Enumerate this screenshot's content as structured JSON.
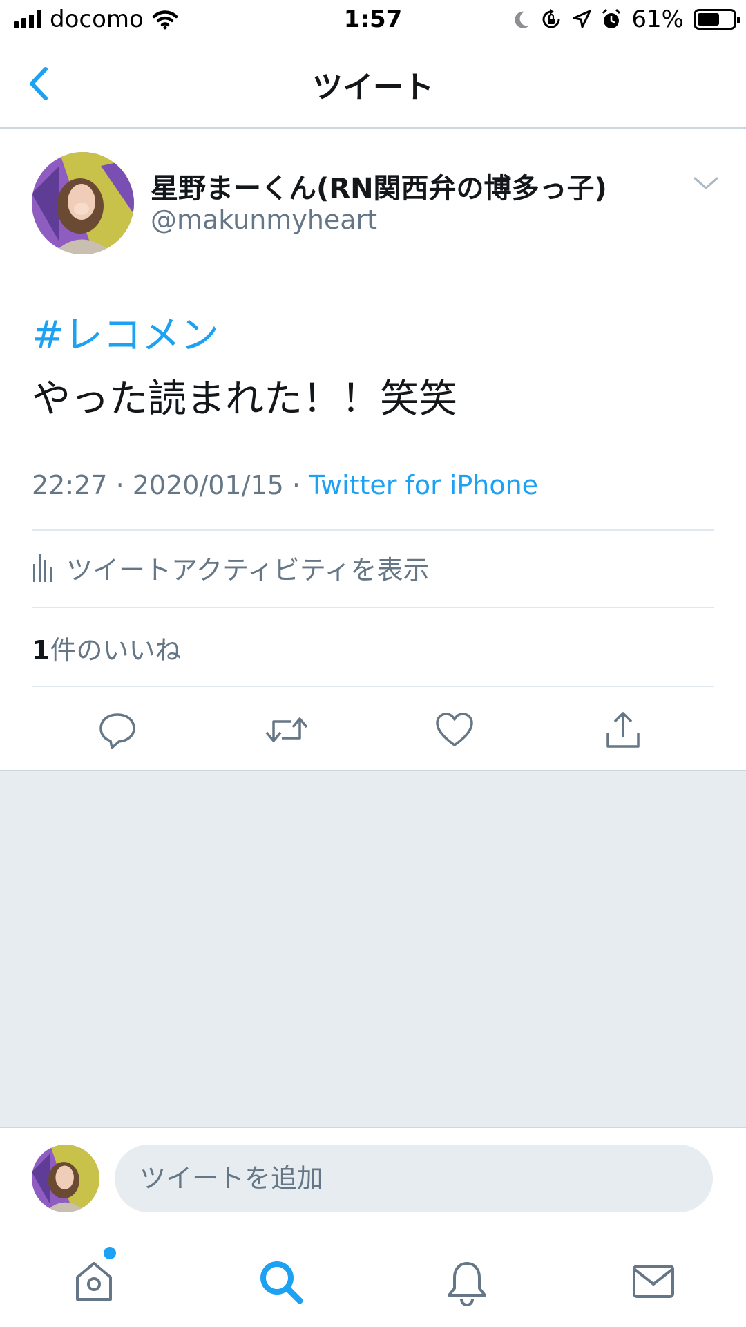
{
  "status_bar": {
    "carrier": "docomo",
    "time": "1:57",
    "battery_percent": "61%",
    "battery_level": 0.61,
    "icons": [
      "signal-icon",
      "wifi-icon",
      "moon-icon",
      "rotation-lock-icon",
      "location-icon",
      "alarm-icon",
      "battery-icon"
    ]
  },
  "nav": {
    "title": "ツイート",
    "back_icon": "chevron-left-icon"
  },
  "tweet": {
    "author_name": "星野まーくん(RN関西弁の博多っ子)",
    "author_handle": "@makunmyheart",
    "hashtag": "#レコメン",
    "text": "やった読まれた！！笑笑",
    "time_date": "22:27 · 2020/01/15 · ",
    "source": "Twitter for iPhone",
    "activity_label": "ツイートアクティビティを表示",
    "likes_count": "1",
    "likes_label": "件のいいね",
    "actions": [
      "reply-icon",
      "retweet-icon",
      "like-icon",
      "share-icon"
    ]
  },
  "reply": {
    "placeholder": "ツイートを追加"
  },
  "tabbar": {
    "tabs": [
      "home-icon",
      "search-icon",
      "notifications-icon",
      "messages-icon"
    ],
    "active": "search-icon"
  },
  "colors": {
    "accent": "#1da1f2",
    "secondary_text": "#657786",
    "background_gray": "#e6ecf0"
  }
}
